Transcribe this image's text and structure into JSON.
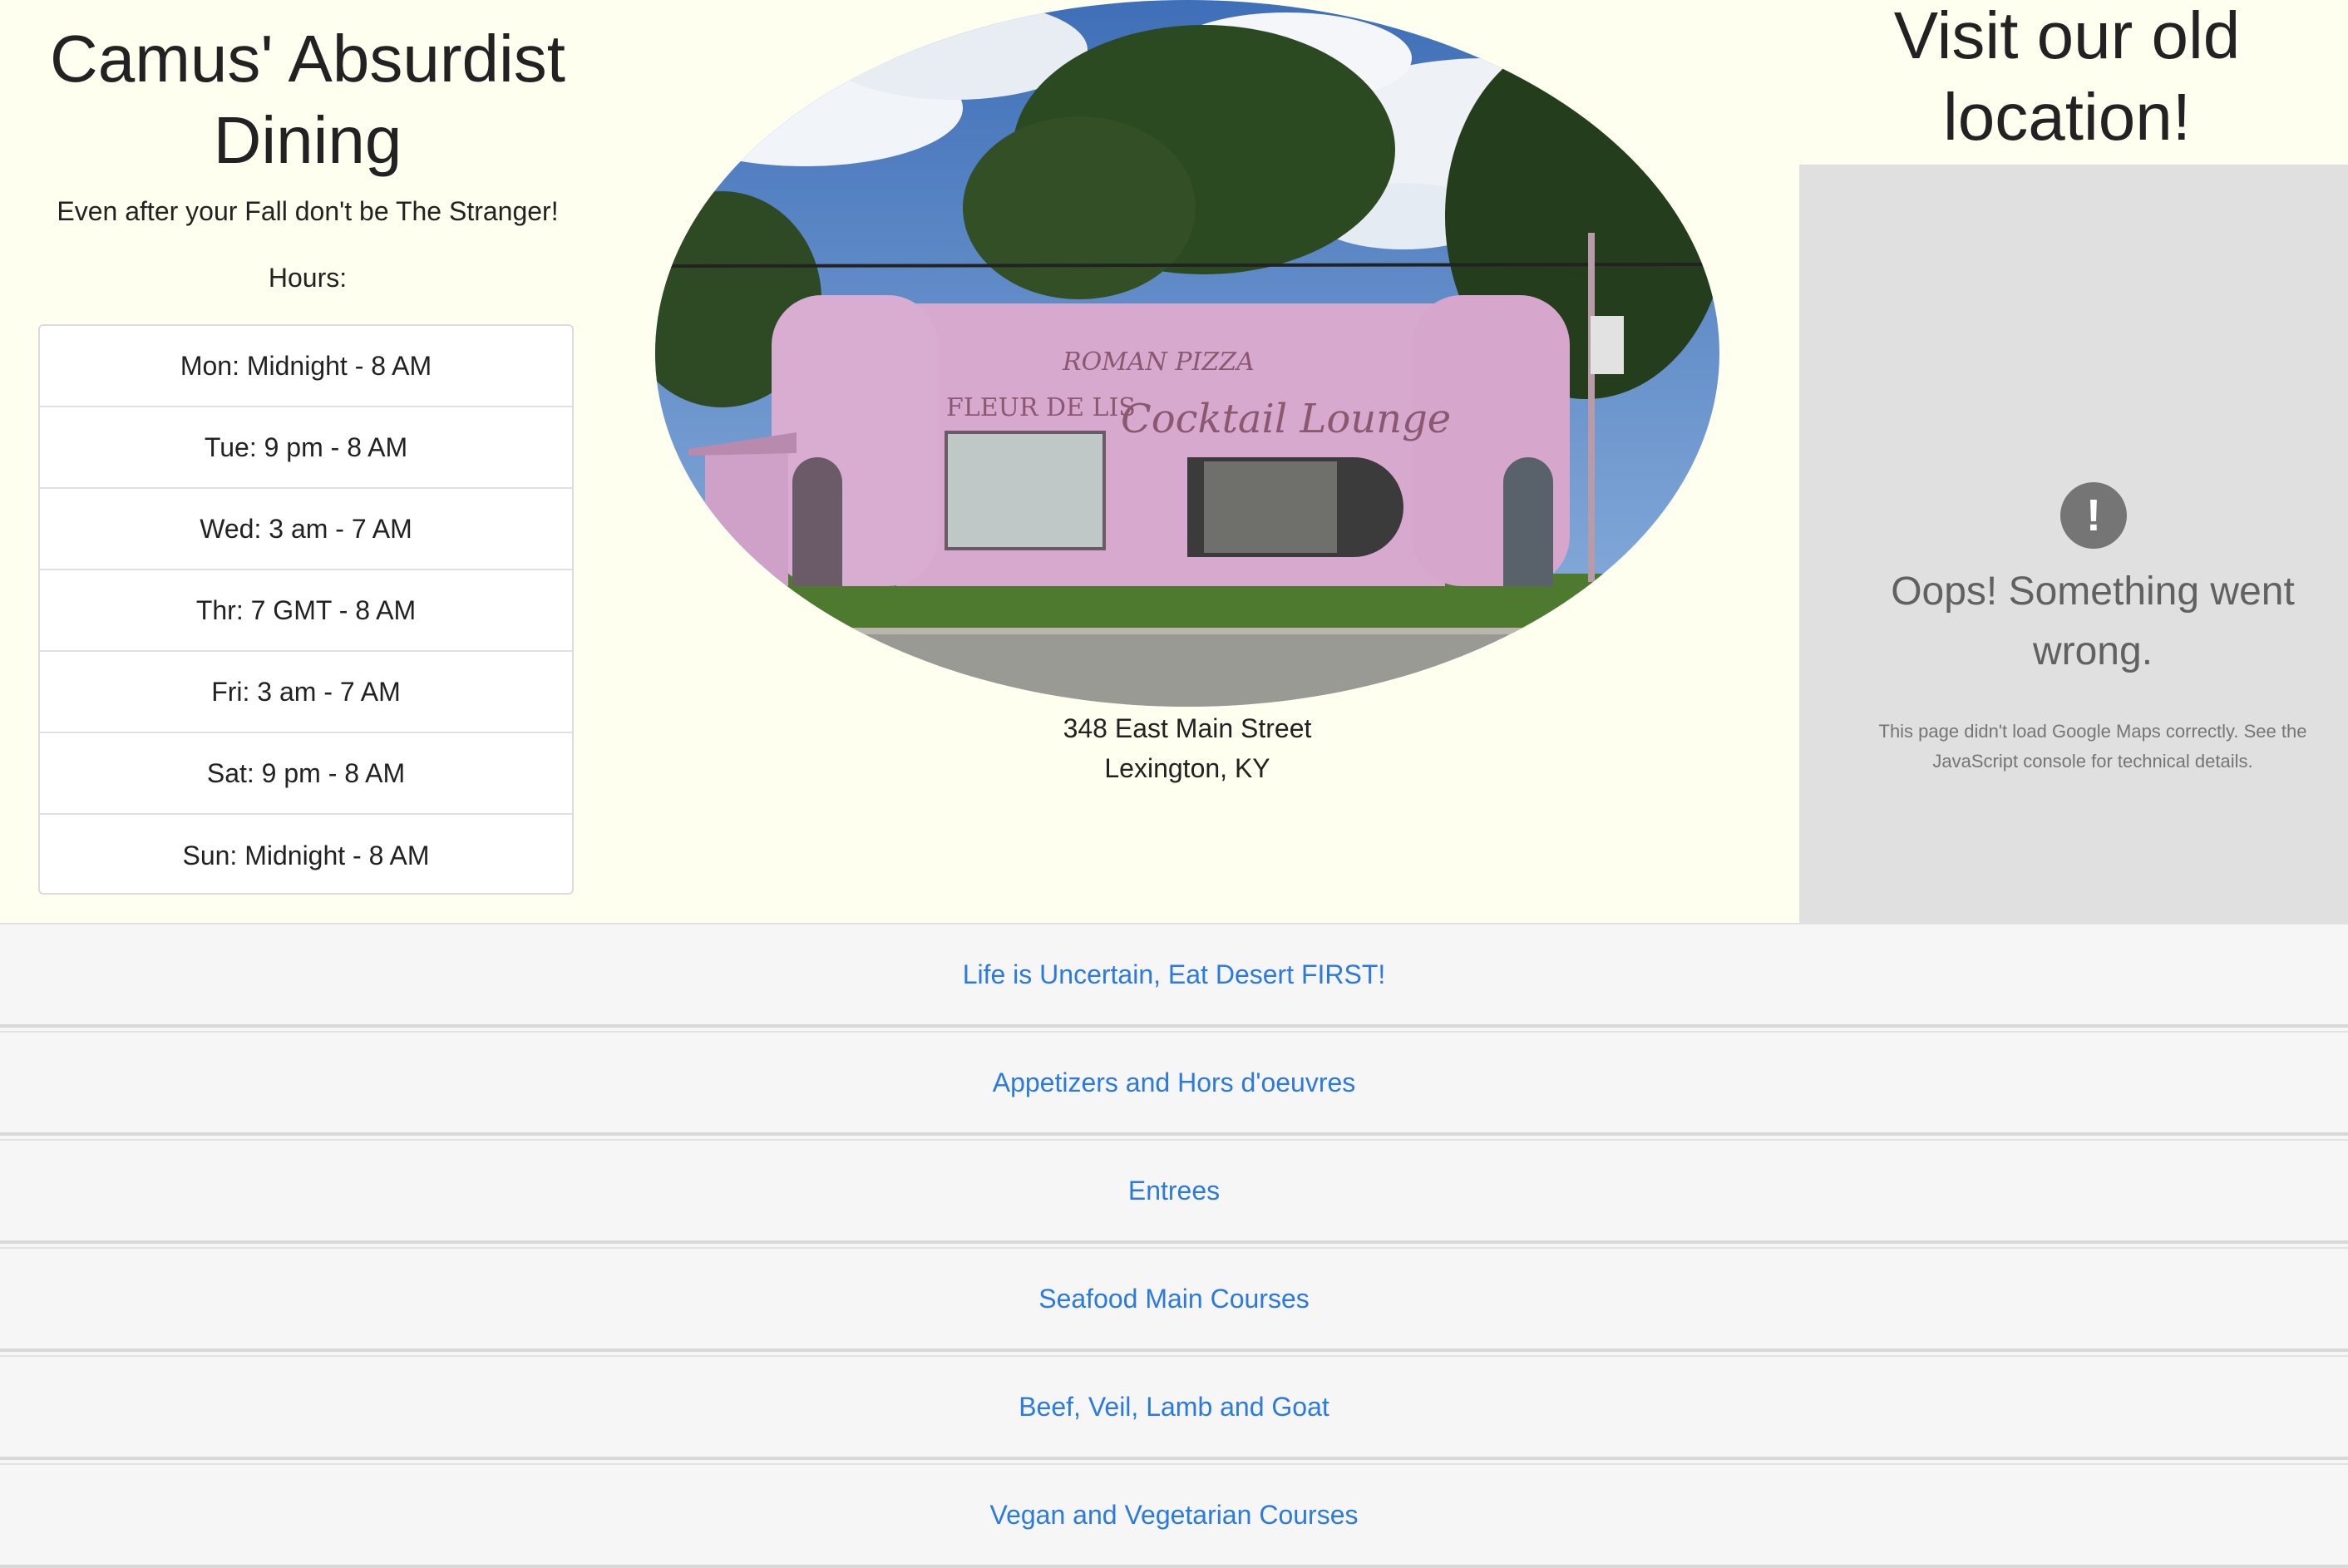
{
  "header": {
    "title": "Camus' Absurdist Dining",
    "tagline": "Even after your Fall don't be The Stranger!",
    "hours_label": "Hours:"
  },
  "hours": [
    "Mon: Midnight - 8 AM",
    "Tue: 9 pm - 8 AM",
    "Wed: 3 am - 7 AM",
    "Thr: 7 GMT - 8 AM",
    "Fri: 3 am - 7 AM",
    "Sat: 9 pm - 8 AM",
    "Sun: Midnight - 8 AM"
  ],
  "photo": {
    "sign_text_1": "ROMAN PIZZA",
    "sign_text_2": "FLEUR DE LIS",
    "sign_text_3": "Cocktail Lounge"
  },
  "address": {
    "street": "348 East Main Street",
    "city": "Lexington, KY"
  },
  "map": {
    "heading": "Visit our old location!",
    "icon": "!",
    "error_title": "Oops! Something went wrong.",
    "error_detail": "This page didn't load Google Maps correctly. See the JavaScript console for technical details."
  },
  "menu": [
    "Life is Uncertain, Eat Desert FIRST!",
    "Appetizers and Hors d'oeuvres",
    "Entrees",
    "Seafood Main Courses",
    "Beef, Veil, Lamb and Goat",
    "Vegan and Vegetarian Courses"
  ],
  "colors": {
    "page_bg": "#fffff0",
    "link": "#2a7ae2",
    "map_bg": "#e0e0e0"
  }
}
